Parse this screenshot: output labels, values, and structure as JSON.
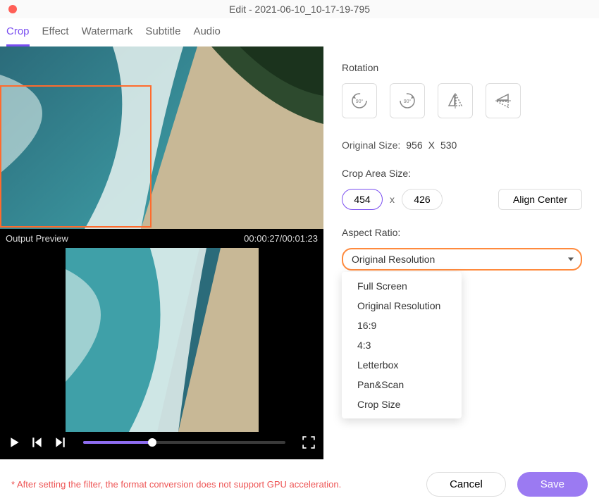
{
  "titlebar": {
    "title": "Edit - 2021-06-10_10-17-19-795"
  },
  "tabs": [
    "Crop",
    "Effect",
    "Watermark",
    "Subtitle",
    "Audio"
  ],
  "active_tab": 0,
  "preview": {
    "label": "Output Preview",
    "time": "00:00:27/00:01:23"
  },
  "rotation": {
    "label": "Rotation",
    "icons": [
      "rotate-ccw-90-icon",
      "rotate-cw-90-icon",
      "flip-horizontal-icon",
      "flip-vertical-icon"
    ]
  },
  "original_size": {
    "label": "Original Size:",
    "w": "956",
    "sep": "X",
    "h": "530"
  },
  "crop_area": {
    "label": "Crop Area Size:",
    "w": "454",
    "h": "426",
    "sep": "x",
    "align": "Align Center"
  },
  "aspect": {
    "label": "Aspect Ratio:",
    "selected": "Original Resolution",
    "options": [
      "Full Screen",
      "Original Resolution",
      "16:9",
      "4:3",
      "Letterbox",
      "Pan&Scan",
      "Crop Size"
    ]
  },
  "footer": {
    "warning": "* After setting the filter, the format conversion does not support GPU acceleration.",
    "cancel": "Cancel",
    "save": "Save"
  }
}
